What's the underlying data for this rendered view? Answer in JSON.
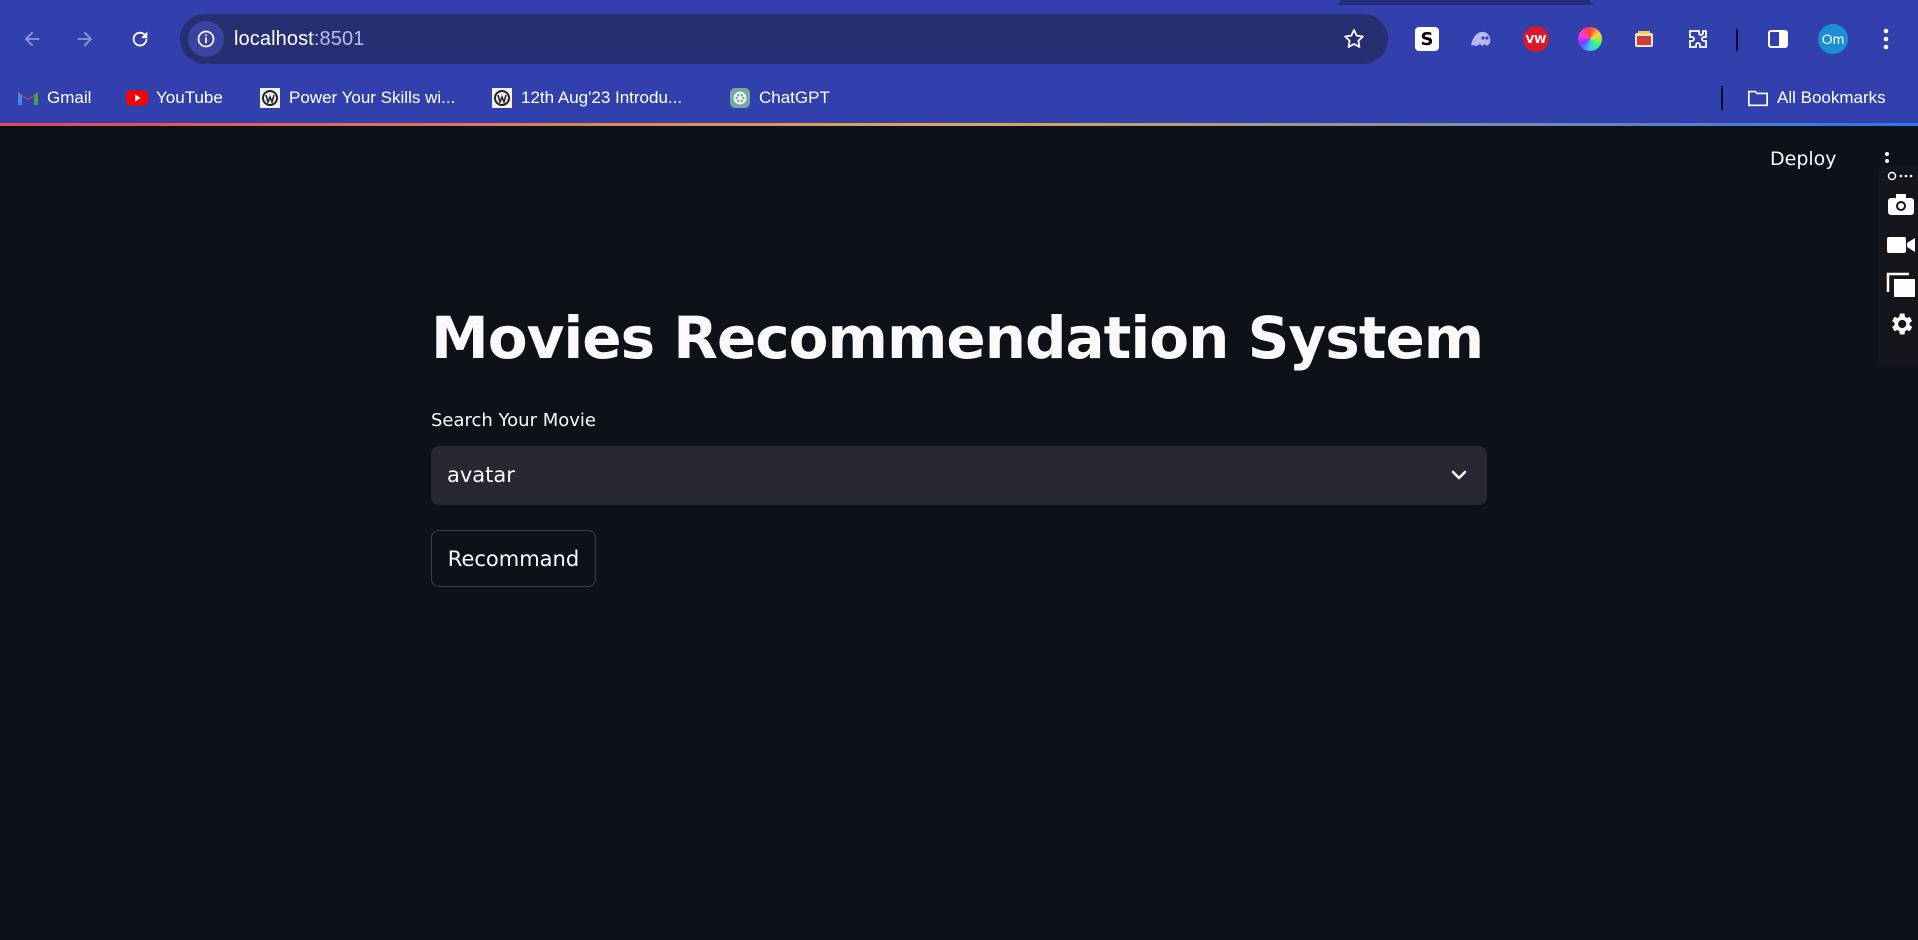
{
  "browser": {
    "url_host": "localhost",
    "url_port": ":8501",
    "profile_initials": "Om",
    "bookmarks": [
      {
        "label": "Gmail",
        "icon": "gmail-icon"
      },
      {
        "label": "YouTube",
        "icon": "youtube-icon"
      },
      {
        "label": "Power Your Skills wi...",
        "icon": "site-icon"
      },
      {
        "label": "12th Aug'23 Introdu...",
        "icon": "site-icon"
      },
      {
        "label": "ChatGPT",
        "icon": "chatgpt-icon"
      }
    ],
    "all_bookmarks_label": "All Bookmarks",
    "extensions": [
      "s-extension-icon",
      "ghost-extension-icon",
      "vw-extension-icon",
      "color-picker-extension-icon",
      "screenshot-extension-icon",
      "puzzle-extensions-icon"
    ],
    "colors": {
      "toolbar": "#3240ad",
      "omnibox": "#272f73"
    }
  },
  "app": {
    "deploy_label": "Deploy",
    "title": "Movies Recommendation System",
    "select_label": "Search Your Movie",
    "select_value": "avatar",
    "button_label": "Recommand",
    "colors": {
      "background": "#0e1117",
      "input": "#262730",
      "text": "#fafafa"
    }
  }
}
